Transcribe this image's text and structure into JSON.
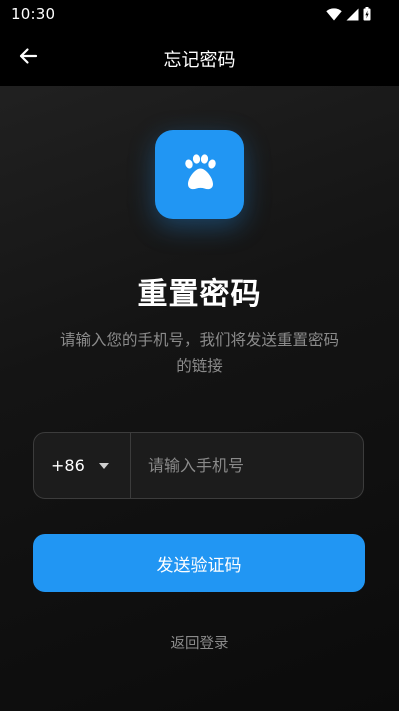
{
  "status_bar": {
    "time": "10:30",
    "icons": [
      "wifi-icon",
      "signal-icon",
      "battery-icon"
    ]
  },
  "header": {
    "back_icon": "arrow-left-icon",
    "title": "忘记密码"
  },
  "logo": {
    "icon": "paw-icon",
    "background_color": "#2196f3"
  },
  "main": {
    "heading": "重置密码",
    "description_line1": "请输入您的手机号，我们将发送重置密码",
    "description_line2": "的链接"
  },
  "phone_field": {
    "country_code": "+86",
    "country_code_icon": "dropdown-caret-icon",
    "value": "",
    "placeholder": "请输入手机号"
  },
  "send_button": {
    "label": "发送验证码",
    "color": "#2196f3"
  },
  "return_link": {
    "label": "返回登录"
  }
}
